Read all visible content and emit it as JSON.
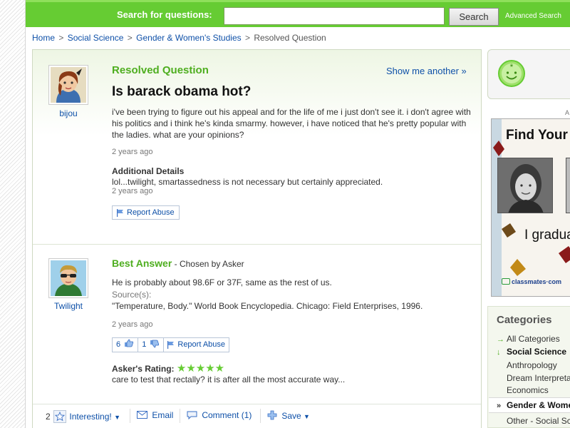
{
  "search": {
    "label": "Search for questions:",
    "placeholder": "",
    "button": "Search",
    "advanced": "Advanced Search"
  },
  "breadcrumb": {
    "items": [
      "Home",
      "Social Science",
      "Gender & Women's Studies"
    ],
    "current": "Resolved Question",
    "separator": ">"
  },
  "question": {
    "status": "Resolved Question",
    "show_another": "Show me another »",
    "title": "Is barack obama hot?",
    "asker": "bijou",
    "body": "i've been trying to figure out his appeal and for the life of me i just don't see it. i don't agree with his politics and i think he's kinda smarmy. however, i have noticed that he's pretty popular with the ladies. what are your opinions?",
    "time": "2 years ago",
    "details_heading": "Additional Details",
    "details": "lol...twilight, smartassedness is not necessary but certainly appreciated.",
    "details_time": "2 years ago",
    "report": "Report Abuse"
  },
  "best_answer": {
    "heading": "Best Answer",
    "chosen_by": " - Chosen by Asker",
    "answerer": "Twilight",
    "text": "He is probably about 98.6F or 37F, same as the rest of us.",
    "sources_label": "Source(s):",
    "source": "\"Temperature, Body.\" World Book Encyclopedia. Chicago: Field Enterprises, 1996.",
    "time": "2 years ago",
    "thumbs_up": "6",
    "thumbs_down": "1",
    "report": "Report Abuse",
    "rating_label": "Asker's Rating:",
    "rating_stars": "★★★★★",
    "rating_value": 5,
    "rating_comment": "care to test that rectally? it is after all the most accurate way..."
  },
  "bottom_bar": {
    "interesting_count": "2",
    "interesting": "Interesting!",
    "email": "Email",
    "comment": "Comment (1)",
    "save": "Save"
  },
  "sidebar": {
    "ad_marker": "A",
    "ad_title": "Find Your",
    "ad_text": "I gradua",
    "ad_brand": "classmates·com",
    "categories_heading": "Categories",
    "categories": [
      {
        "label": "All Categories"
      },
      {
        "label": "Social Science"
      },
      {
        "label": "Anthropology"
      },
      {
        "label": "Dream Interpreta"
      },
      {
        "label": "Economics"
      },
      {
        "label": "Gender & Women"
      },
      {
        "label": "Other - Social Sc"
      }
    ]
  },
  "colors": {
    "brand_green": "#66cc33",
    "link_blue": "#0e50a8",
    "heading_green": "#4eae1f"
  }
}
